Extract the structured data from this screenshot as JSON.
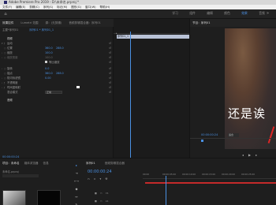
{
  "titlebar": {
    "title": "Adobe Premiere Pro 2019 - D:\\未命名.prproj *"
  },
  "menubar": {
    "items": [
      "文件(F)",
      "编辑(E)",
      "剪辑(C)",
      "序列(S)",
      "标记(M)",
      "图形(G)",
      "窗口(W)",
      "帮助(H)"
    ]
  },
  "workspace": {
    "tabs": [
      "学习",
      "组件",
      "编辑",
      "颜色",
      "效果",
      "音频"
    ],
    "active_index": 4
  },
  "effect_controls": {
    "tabs": [
      "效果控件",
      "Lumetri 范围",
      "源：(无剪辑)",
      "音频剪辑混合器：序列01"
    ],
    "source": "主要*序列01",
    "clip": "序列01 * 序列01_1",
    "rows": [
      {
        "label": "视频",
        "type": "section"
      },
      {
        "label": "运动",
        "type": "group"
      },
      {
        "label": "位置",
        "v1": "360.0",
        "v2": "288.0"
      },
      {
        "label": "缩放",
        "v1": "100.0"
      },
      {
        "label": "缩放宽度",
        "v1": "100.0"
      },
      {
        "label": "等比缩放",
        "type": "check"
      },
      {
        "label": "旋转",
        "v1": "0.0"
      },
      {
        "label": "锚点",
        "v1": "360.0",
        "v2": "288.0"
      },
      {
        "label": "防闪烁滤镜",
        "v1": "0.00"
      },
      {
        "label": "不透明度",
        "type": "group"
      },
      {
        "label": "时间重映射",
        "type": "group"
      },
      {
        "label": "混合模式",
        "select": "正常"
      },
      {
        "label": "音频",
        "type": "section"
      }
    ],
    "footer_time": "00:00:00:24",
    "clip_name": "序列01_1"
  },
  "program_monitor": {
    "title": "节目：序列01",
    "subtitle": "还是诶",
    "timecode": "00:00:00:24",
    "fit": "适合"
  },
  "project": {
    "tabs": [
      "项目：未命名",
      "媒体浏览器",
      "信息"
    ],
    "path": "未命名.prproj"
  },
  "timeline": {
    "tabs": [
      "序列01",
      "音频剪辑混合器"
    ],
    "timecode": "00:00:00:24",
    "ruler_labels": [
      "00:00",
      "00:00:05:00",
      "00:00:10:00",
      "00:00:15:00",
      "00:00:20:00",
      "00:00:25:00"
    ],
    "tracks": [
      "V1",
      "A1",
      "A2"
    ]
  },
  "colors": {
    "accent": "#4a90e2",
    "work_area": "#c42a2a",
    "subtitle": "#ffffff"
  }
}
